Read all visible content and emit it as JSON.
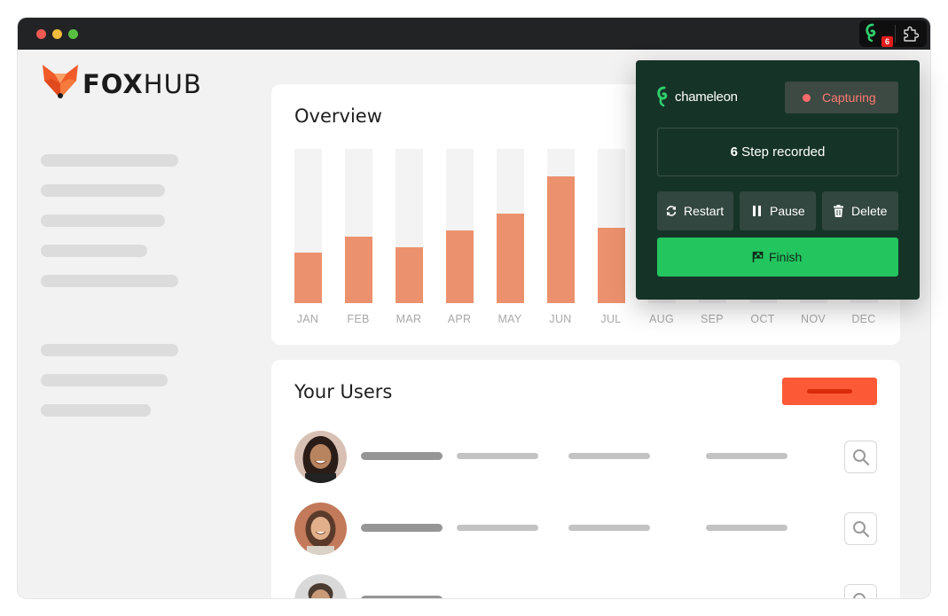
{
  "app": {
    "logo": {
      "bold": "FOX",
      "light": "HUB"
    },
    "browser": {
      "extension_badge": "6"
    }
  },
  "overview": {
    "title": "Overview",
    "chart_data": {
      "type": "bar",
      "categories": [
        "JAN",
        "FEB",
        "MAR",
        "APR",
        "MAY",
        "JUN",
        "JUL",
        "AUG",
        "SEP",
        "OCT",
        "NOV",
        "DEC"
      ],
      "values": [
        33,
        43,
        36,
        47,
        58,
        82,
        49,
        null,
        null,
        null,
        null,
        null
      ],
      "ylim": [
        0,
        100
      ],
      "grid": false,
      "colors": {
        "bar": "#ec916d",
        "track": "#f3f3f3"
      }
    }
  },
  "users": {
    "title": "Your Users",
    "rows": [
      {
        "avatar": "avatar-photo"
      },
      {
        "avatar": "avatar-photo"
      },
      {
        "avatar": "avatar-photo"
      }
    ]
  },
  "recorder": {
    "brand": "chameleon",
    "status": "Capturing",
    "steps_count": "6",
    "steps_label": "Step recorded",
    "restart_label": "Restart",
    "pause_label": "Pause",
    "delete_label": "Delete",
    "finish_label": "Finish",
    "colors": {
      "panel": "#163328",
      "finish": "#23c55e",
      "capturing_text": "#ff7a72"
    }
  }
}
